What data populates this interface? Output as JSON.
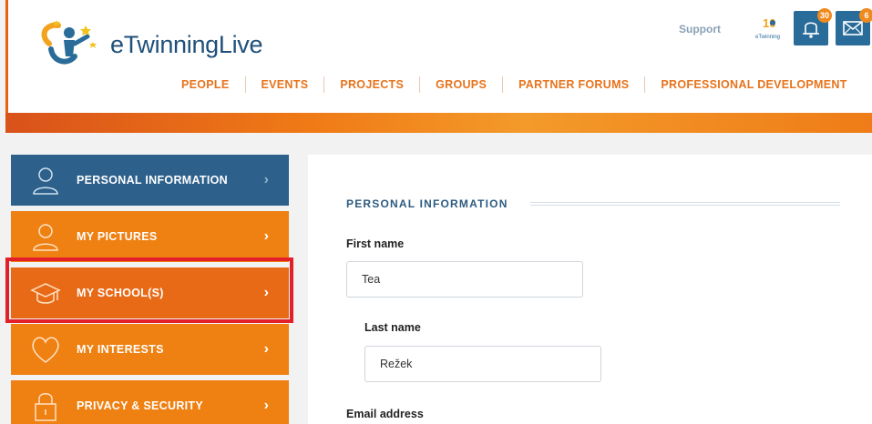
{
  "header": {
    "logo_text": "eTwinningLive",
    "support_label": "Support",
    "badge_label": "eTwinning",
    "notifications_count": "30",
    "messages_count": "6",
    "nav": [
      "PEOPLE",
      "EVENTS",
      "PROJECTS",
      "GROUPS",
      "PARTNER FORUMS",
      "PROFESSIONAL DEVELOPMENT"
    ]
  },
  "sidebar": {
    "items": [
      {
        "label": "PERSONAL INFORMATION",
        "icon": "user-icon"
      },
      {
        "label": "MY PICTURES",
        "icon": "user-outline-icon"
      },
      {
        "label": "MY SCHOOL(S)",
        "icon": "graduation-cap-icon"
      },
      {
        "label": "MY INTERESTS",
        "icon": "heart-icon"
      },
      {
        "label": "PRIVACY & SECURITY",
        "icon": "lock-icon"
      }
    ],
    "arrow": "›"
  },
  "main": {
    "section_title": "PERSONAL INFORMATION",
    "first_name_label": "First name",
    "first_name_value": "Tea",
    "last_name_label": "Last name",
    "last_name_value": "Režek",
    "email_label": "Email address"
  },
  "colors": {
    "accent_orange": "#ef8012",
    "active_blue": "#2d618b",
    "highlight_red": "#e3202a"
  }
}
